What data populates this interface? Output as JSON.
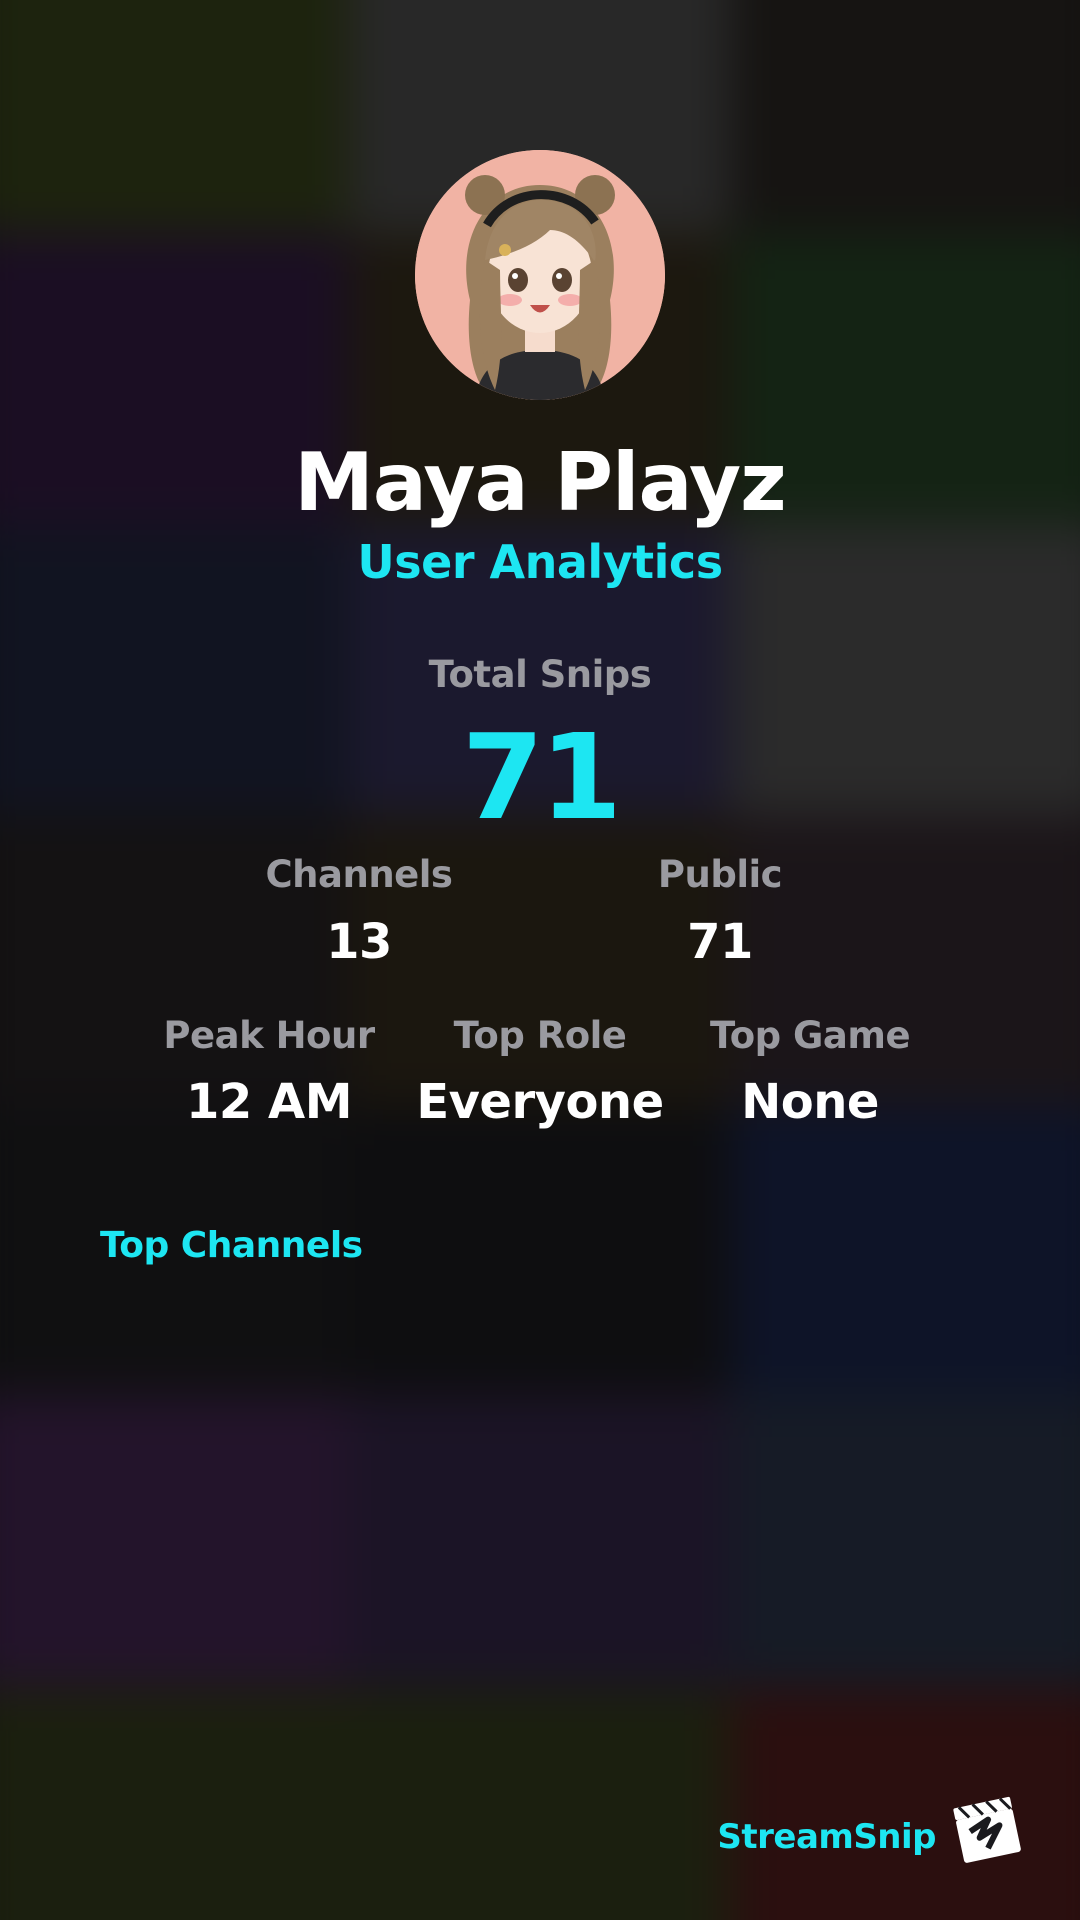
{
  "profile": {
    "name": "Maya Playz",
    "subtitle": "User Analytics"
  },
  "stats": {
    "total_snips": {
      "label": "Total Snips",
      "value": "71"
    },
    "channels": {
      "label": "Channels",
      "value": "13"
    },
    "public": {
      "label": "Public",
      "value": "71"
    },
    "peak_hour": {
      "label": "Peak Hour",
      "value": "12 AM"
    },
    "top_role": {
      "label": "Top Role",
      "value": "Everyone"
    },
    "top_game": {
      "label": "Top Game",
      "value": "None"
    }
  },
  "sections": {
    "top_channels": "Top Channels"
  },
  "brand": {
    "name": "StreamSnip"
  },
  "colors": {
    "accent": "#1de6f2",
    "label": "#9a9aa0",
    "value": "#ffffff",
    "avatar_bg": "#f1b3a4"
  },
  "icons": {
    "avatar": "avatar-image",
    "brand_logo": "clapperboard-icon"
  }
}
